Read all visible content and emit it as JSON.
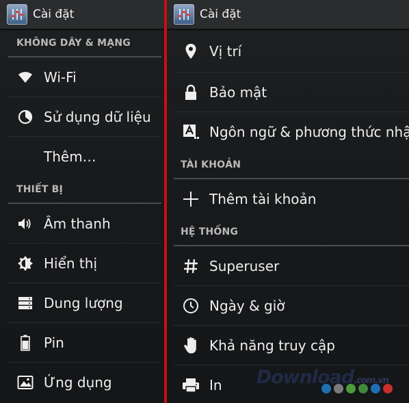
{
  "app": {
    "title": "Cài đặt"
  },
  "left": {
    "sections": {
      "wireless": "KHÔNG DÂY & MẠNG",
      "device": "THIẾT BỊ"
    },
    "items": {
      "wifi": "Wi-Fi",
      "data_usage": "Sử dụng dữ liệu",
      "more": "Thêm…",
      "sound": "Âm thanh",
      "display": "Hiển thị",
      "storage": "Dung lượng",
      "battery": "Pin",
      "apps": "Ứng dụng"
    }
  },
  "right": {
    "sections": {
      "accounts": "TÀI KHOẢN",
      "system": "HỆ THỐNG"
    },
    "items": {
      "location": "Vị trí",
      "security": "Bảo mật",
      "language": "Ngôn ngữ & phương thức nhập",
      "add_account": "Thêm tài khoản",
      "superuser": "Superuser",
      "date_time": "Ngày & giờ",
      "accessibility": "Khả năng truy cập",
      "printing": "In"
    }
  },
  "watermark": {
    "text": "Download",
    "suffix": ".com.vn"
  },
  "colors": {
    "divider": "#c80f16",
    "dots": [
      "#1f6fb5",
      "#7a7a7a",
      "#4f9a3a",
      "#3f8a3a",
      "#1f6fb5",
      "#c8302b"
    ]
  }
}
